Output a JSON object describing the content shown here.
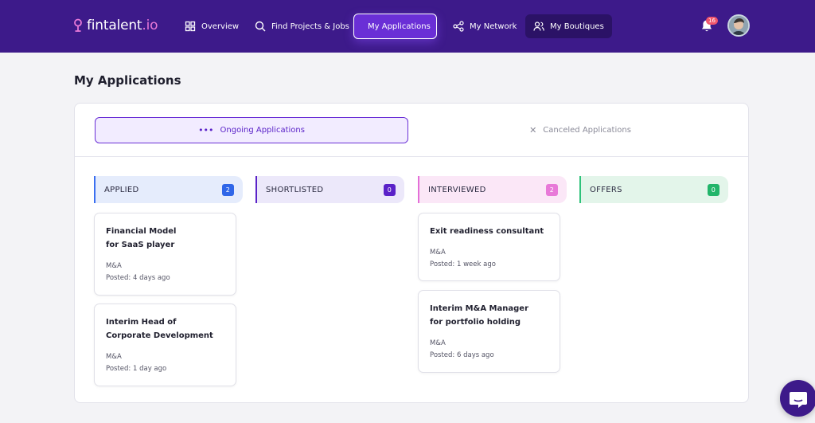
{
  "brand": {
    "name": "fintalent",
    "suffix": ".io"
  },
  "nav": {
    "items": [
      {
        "label": "Overview"
      },
      {
        "label": "Find Projects & Jobs"
      },
      {
        "label": "My Applications"
      },
      {
        "label": "My Network"
      },
      {
        "label": "My Boutiques"
      }
    ],
    "notifications_count": "16"
  },
  "page": {
    "title": "My Applications"
  },
  "tabs": {
    "ongoing": {
      "label": "Ongoing Applications",
      "icon": "more-dots-icon"
    },
    "canceled": {
      "label": "Canceled Applications",
      "icon": "close-icon"
    }
  },
  "columns": [
    {
      "title": "APPLIED",
      "count": "2",
      "color": "#2f66e8",
      "cards": [
        {
          "title": "Financial Model for SaaS player",
          "category": "M&A",
          "posted": "Posted: 4 days ago"
        },
        {
          "title": "Interim Head of Corporate Development",
          "category": "M&A",
          "posted": "Posted: 1 day ago"
        }
      ]
    },
    {
      "title": "SHORTLISTED",
      "count": "0",
      "color": "#5a22c8",
      "cards": []
    },
    {
      "title": "INTERVIEWED",
      "count": "2",
      "color": "#e879d8",
      "cards": [
        {
          "title": "Exit readiness consultant",
          "category": "M&A",
          "posted": "Posted: 1 week ago"
        },
        {
          "title": "Interim M&A Manager for portfolio holding",
          "category": "M&A",
          "posted": "Posted: 6 days ago"
        }
      ]
    },
    {
      "title": "OFFERS",
      "count": "0",
      "color": "#22b56a",
      "cards": []
    }
  ]
}
